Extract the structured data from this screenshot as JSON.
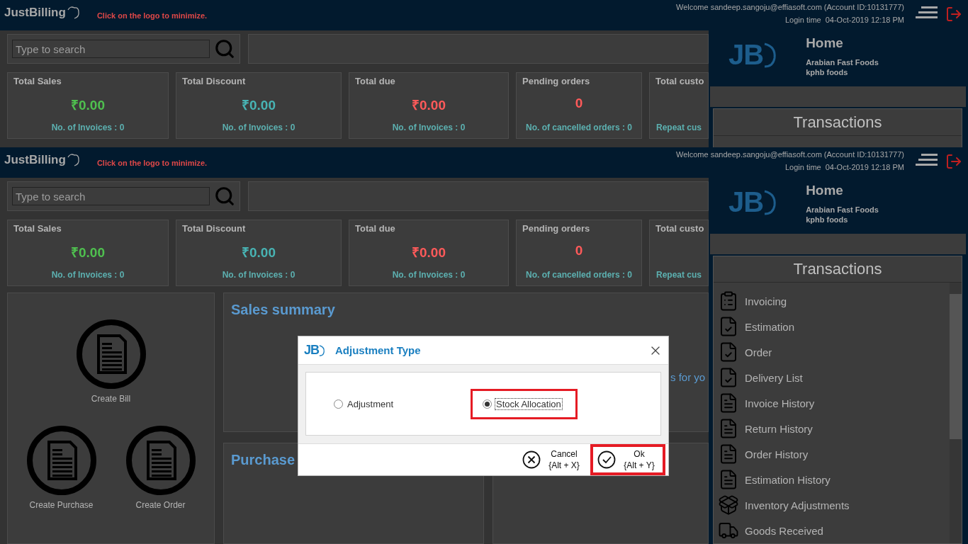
{
  "screens": [
    {
      "header": {
        "logo": "JustBilling",
        "hint": "Click on the logo to minimize.",
        "welcome": "Welcome sandeep.sangoju@effiasoft.com (Account ID:10131777)",
        "login_label": "Login time",
        "login_time": "04-Oct-2019 12:18 PM"
      },
      "search": {
        "placeholder": "Type to search"
      },
      "stats": [
        {
          "title": "Total Sales",
          "value": "₹0.00",
          "color": "#4fc04f",
          "footer": "No. of Invoices : 0"
        },
        {
          "title": "Total Discount",
          "value": "₹0.00",
          "color": "#48b4b4",
          "footer": "No. of Invoices : 0"
        },
        {
          "title": "Total due",
          "value": "₹0.00",
          "color": "#ff5a5a",
          "footer": "No. of Invoices : 0"
        },
        {
          "title": "Pending orders",
          "value": "0",
          "color": "#ff5a5a",
          "footer": "No. of cancelled orders : 0"
        },
        {
          "title": "Total custo",
          "footer": "Repeat cus"
        }
      ],
      "sidebar": {
        "logo": "JB",
        "title": "Home",
        "org": "Arabian Fast Foods",
        "branch": "kphb foods",
        "section": "Transactions"
      }
    },
    {
      "header": {
        "logo": "JustBilling",
        "hint": "Click on the logo to minimize.",
        "welcome": "Welcome sandeep.sangoju@effiasoft.com (Account ID:10131777)",
        "login_label": "Login time",
        "login_time": "04-Oct-2019 12:18 PM"
      },
      "search": {
        "placeholder": "Type to search"
      },
      "stats": [
        {
          "title": "Total Sales",
          "value": "₹0.00",
          "color": "#4fc04f",
          "footer": "No. of Invoices : 0"
        },
        {
          "title": "Total Discount",
          "value": "₹0.00",
          "color": "#48b4b4",
          "footer": "No. of Invoices : 0"
        },
        {
          "title": "Total due",
          "value": "₹0.00",
          "color": "#ff5a5a",
          "footer": "No. of Invoices : 0"
        },
        {
          "title": "Pending orders",
          "value": "0",
          "color": "#ff5a5a",
          "footer": "No. of cancelled orders : 0"
        },
        {
          "title": "Total custo",
          "footer": "Repeat cus"
        }
      ],
      "quick_actions": [
        {
          "label": "Create Bill"
        },
        {
          "label": "Create Purchase"
        },
        {
          "label": "Create Order"
        }
      ],
      "panels": [
        {
          "title": "Sales summary",
          "text": "s for yo"
        },
        {
          "title": "Purchase"
        }
      ],
      "sidebar": {
        "logo": "JB",
        "title": "Home",
        "org": "Arabian Fast Foods",
        "branch": "kphb foods",
        "section": "Transactions",
        "items": [
          {
            "label": "Invoicing"
          },
          {
            "label": "Estimation"
          },
          {
            "label": "Order"
          },
          {
            "label": "Delivery List"
          },
          {
            "label": "Invoice History"
          },
          {
            "label": "Return History"
          },
          {
            "label": "Order History"
          },
          {
            "label": "Estimation History"
          },
          {
            "label": "Inventory Adjustments"
          },
          {
            "label": "Goods Received"
          }
        ]
      }
    }
  ],
  "dialog": {
    "logo": "JB",
    "title": "Adjustment Type",
    "options": [
      {
        "label": "Adjustment",
        "selected": false,
        "highlighted": false
      },
      {
        "label": "Stock Allocation",
        "selected": true,
        "highlighted": true
      }
    ],
    "buttons": [
      {
        "kind": "cancel",
        "label": "Cancel",
        "shortcut": "{Alt + X}",
        "highlighted": false
      },
      {
        "kind": "ok",
        "label": "Ok",
        "shortcut": "{Alt + Y}",
        "highlighted": true
      }
    ]
  }
}
